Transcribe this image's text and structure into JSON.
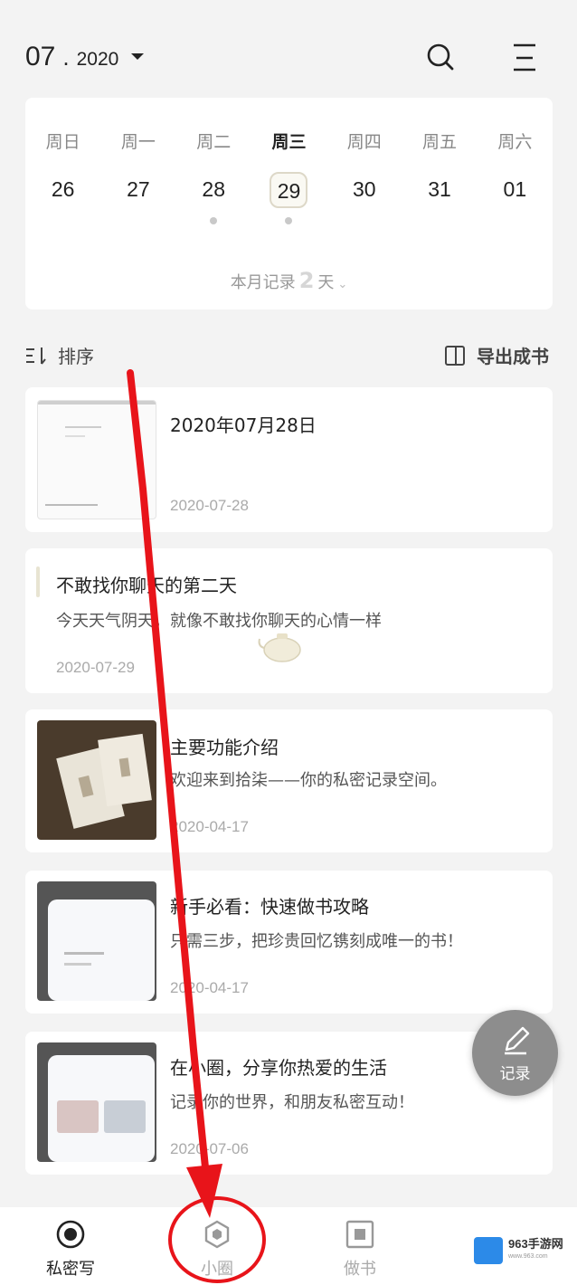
{
  "header": {
    "month": "07",
    "separator": ".",
    "year": "2020"
  },
  "calendar": {
    "weekdays": [
      "周日",
      "周一",
      "周二",
      "周三",
      "周四",
      "周五",
      "周六"
    ],
    "dates": [
      "26",
      "27",
      "28",
      "29",
      "30",
      "31",
      "01"
    ],
    "selected_index": 3,
    "summary_prefix": "本月记录",
    "summary_count": "2",
    "summary_suffix": "天"
  },
  "toolbar": {
    "sort_label": "排序",
    "export_label": "导出成书"
  },
  "entries": [
    {
      "title": "2020年07月28日",
      "text": "",
      "date": "2020-07-28"
    },
    {
      "title": "不敢找你聊天的第二天",
      "text": "今天天气阴天，就像不敢找你聊天的心情一样",
      "date": "2020-07-29"
    },
    {
      "title": "主要功能介绍",
      "text": "欢迎来到拾柒——你的私密记录空间。",
      "date": "2020-04-17"
    },
    {
      "title": "新手必看：快速做书攻略",
      "text": "只需三步，把珍贵回忆镌刻成唯一的书！",
      "date": "2020-04-17"
    },
    {
      "title": "在小圈，分享你热爱的生活",
      "text": "记录你的世界，和朋友私密互动！",
      "date": "2020-07-06"
    }
  ],
  "fab": {
    "label": "记录"
  },
  "nav": [
    {
      "label": "私密写"
    },
    {
      "label": "小圈"
    },
    {
      "label": "做书"
    }
  ],
  "watermark": {
    "brand": "963手游网",
    "site": "www.963.com"
  },
  "colors": {
    "background": "#f3f3f3",
    "card": "#ffffff",
    "annotation_red": "#e8141a",
    "fab": "#8d8d8d"
  }
}
